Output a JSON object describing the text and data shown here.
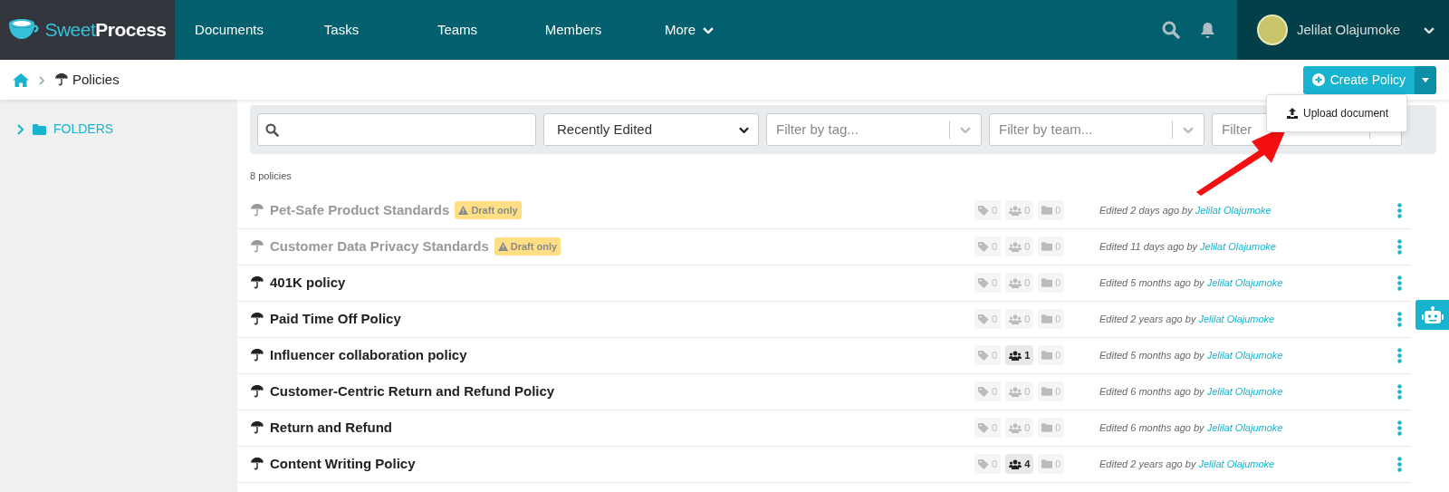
{
  "brand": {
    "light": "Sweet",
    "bold": "Process"
  },
  "nav": [
    {
      "label": "Documents",
      "dropdown": false
    },
    {
      "label": "Tasks",
      "dropdown": false
    },
    {
      "label": "Teams",
      "dropdown": false
    },
    {
      "label": "Members",
      "dropdown": false
    },
    {
      "label": "More",
      "dropdown": true
    }
  ],
  "user": {
    "name": "Jelilat Olajumoke"
  },
  "breadcrumb": {
    "current": "Policies"
  },
  "create_button": {
    "label": "Create Policy"
  },
  "create_menu": {
    "open": true,
    "items": [
      "Upload document"
    ]
  },
  "sidebar": {
    "expanded": false,
    "label": "FOLDERS"
  },
  "filters": {
    "sort": "Recently Edited",
    "tag_placeholder": "Filter by tag...",
    "team_placeholder": "Filter by team...",
    "folder_placeholder": "Filter"
  },
  "count": "8 policies",
  "rows": [
    {
      "title": "Pet-Safe Product Standards",
      "draft": true,
      "badge": "Draft only",
      "tags": {
        "value": "0",
        "active": false
      },
      "teams": {
        "value": "0",
        "active": false
      },
      "folders": {
        "value": "0",
        "active": false
      },
      "edited": "Edited 2 days ago by",
      "author": "Jelilat Olajumoke"
    },
    {
      "title": "Customer Data Privacy Standards",
      "draft": true,
      "badge": "Draft only",
      "tags": {
        "value": "0",
        "active": false
      },
      "teams": {
        "value": "0",
        "active": false
      },
      "folders": {
        "value": "0",
        "active": false
      },
      "edited": "Edited 11 days ago by",
      "author": "Jelilat Olajumoke"
    },
    {
      "title": "401K policy",
      "draft": false,
      "tags": {
        "value": "0",
        "active": false
      },
      "teams": {
        "value": "0",
        "active": false
      },
      "folders": {
        "value": "0",
        "active": false
      },
      "edited": "Edited 5 months ago by",
      "author": "Jelilat Olajumoke"
    },
    {
      "title": "Paid Time Off Policy",
      "draft": false,
      "tags": {
        "value": "0",
        "active": false
      },
      "teams": {
        "value": "0",
        "active": false
      },
      "folders": {
        "value": "0",
        "active": false
      },
      "edited": "Edited 2 years ago by",
      "author": "Jelilat Olajumoke"
    },
    {
      "title": "Influencer collaboration policy",
      "draft": false,
      "tags": {
        "value": "0",
        "active": false
      },
      "teams": {
        "value": "1",
        "active": true
      },
      "folders": {
        "value": "0",
        "active": false
      },
      "edited": "Edited 5 months ago by",
      "author": "Jelilat Olajumoke"
    },
    {
      "title": "Customer-Centric Return and Refund Policy",
      "draft": false,
      "tags": {
        "value": "0",
        "active": false
      },
      "teams": {
        "value": "0",
        "active": false
      },
      "folders": {
        "value": "0",
        "active": false
      },
      "edited": "Edited 6 months ago by",
      "author": "Jelilat Olajumoke"
    },
    {
      "title": "Return and Refund",
      "draft": false,
      "tags": {
        "value": "0",
        "active": false
      },
      "teams": {
        "value": "0",
        "active": false
      },
      "folders": {
        "value": "0",
        "active": false
      },
      "edited": "Edited 6 months ago by",
      "author": "Jelilat Olajumoke"
    },
    {
      "title": "Content Writing Policy",
      "draft": false,
      "tags": {
        "value": "0",
        "active": false
      },
      "teams": {
        "value": "4",
        "active": true
      },
      "folders": {
        "value": "0",
        "active": false
      },
      "edited": "Edited 2 years ago by",
      "author": "Jelilat Olajumoke"
    }
  ]
}
